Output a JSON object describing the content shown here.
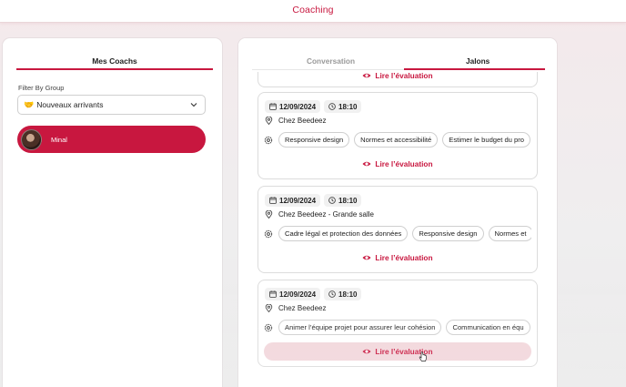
{
  "header": {
    "title": "Coaching"
  },
  "left": {
    "title": "Mes Coachs",
    "filter_label": "Filter By Group",
    "filter_value": "Nouveaux arrivants",
    "filter_icon": "handshake-emoji",
    "coach": {
      "name": "Minal"
    }
  },
  "tabs": [
    {
      "label": "Conversation",
      "active": false
    },
    {
      "label": "Jalons",
      "active": true
    }
  ],
  "read_label": "Lire l’évaluation",
  "cards": [
    {
      "date": "12/09/2024",
      "time": "18:10",
      "location": "Chez Beedeez",
      "tags": [
        "Responsive design",
        "Normes et accessibilité",
        "Estimer le budget du pro"
      ]
    },
    {
      "date": "12/09/2024",
      "time": "18:10",
      "location": "Chez Beedeez - Grande salle",
      "tags": [
        "Cadre légal et protection des données",
        "Responsive design",
        "Normes et"
      ]
    },
    {
      "date": "12/09/2024",
      "time": "18:10",
      "location": "Chez Beedeez",
      "tags": [
        "Animer l’équipe projet pour assurer leur cohésion",
        "Communication en équ"
      ]
    }
  ],
  "colors": {
    "accent": "#c8173f",
    "hover_bg": "#f2d6db"
  }
}
